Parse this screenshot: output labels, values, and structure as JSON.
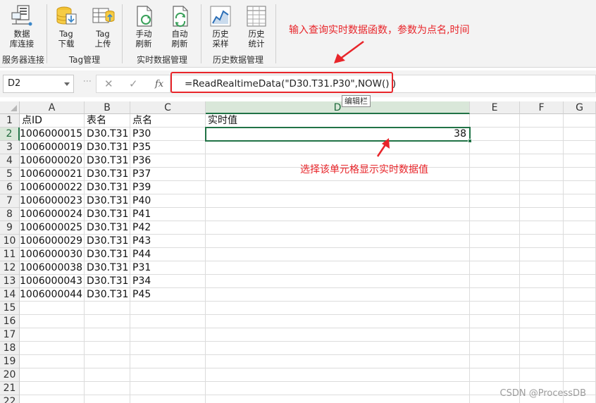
{
  "ribbon": {
    "buttons": [
      {
        "id": "db-connect",
        "label": "数据\n库连接",
        "icon": "server-connect-icon"
      },
      {
        "id": "tag-download",
        "label": "Tag\n下载",
        "icon": "database-download-icon"
      },
      {
        "id": "tag-upload",
        "label": "Tag\n上传",
        "icon": "table-upload-icon"
      },
      {
        "id": "manual-refresh",
        "label": "手动\n刷新",
        "icon": "document-refresh-icon"
      },
      {
        "id": "auto-refresh",
        "label": "自动\n刷新",
        "icon": "document-autorefresh-icon"
      },
      {
        "id": "history-sample",
        "label": "历史\n采样",
        "icon": "line-chart-icon"
      },
      {
        "id": "history-stats",
        "label": "历史\n统计",
        "icon": "spreadsheet-stats-icon"
      }
    ],
    "groups": {
      "server": "服务器连接",
      "tag": "Tag管理",
      "realtime": "实时数据管理",
      "history": "历史数据管理"
    }
  },
  "annotations": {
    "top": "输入查询实时数据函数，参数为点名,时间",
    "cell": "选择该单元格显示实时数据值"
  },
  "formula_bar": {
    "name_box": "D2",
    "fx": "fx",
    "formula": "=ReadRealtimeData(\"D30.T31.P30\",NOW() )",
    "tooltip": "编辑栏"
  },
  "sheet": {
    "columns": [
      "A",
      "B",
      "C",
      "D",
      "E",
      "F",
      "G"
    ],
    "selected_column": "D",
    "selected_row": 2,
    "row_numbers": [
      "1",
      "2",
      "3",
      "4",
      "5",
      "6",
      "7",
      "8",
      "9",
      "10",
      "11",
      "12",
      "13",
      "14",
      "15",
      "16",
      "17",
      "18",
      "19",
      "20",
      "21",
      "22"
    ],
    "headers": {
      "A": "点ID",
      "B": "表名",
      "C": "点名",
      "D": "实时值"
    },
    "rows": [
      [
        "1006000015",
        "D30.T31",
        "P30",
        "38"
      ],
      [
        "1006000019",
        "D30.T31",
        "P35",
        ""
      ],
      [
        "1006000020",
        "D30.T31",
        "P36",
        ""
      ],
      [
        "1006000021",
        "D30.T31",
        "P37",
        ""
      ],
      [
        "1006000022",
        "D30.T31",
        "P39",
        ""
      ],
      [
        "1006000023",
        "D30.T31",
        "P40",
        ""
      ],
      [
        "1006000024",
        "D30.T31",
        "P41",
        ""
      ],
      [
        "1006000025",
        "D30.T31",
        "P42",
        ""
      ],
      [
        "1006000029",
        "D30.T31",
        "P43",
        ""
      ],
      [
        "1006000030",
        "D30.T31",
        "P44",
        ""
      ],
      [
        "1006000038",
        "D30.T31",
        "P31",
        ""
      ],
      [
        "1006000043",
        "D30.T31",
        "P34",
        ""
      ],
      [
        "1006000044",
        "D30.T31",
        "P45",
        ""
      ]
    ]
  },
  "watermark": "CSDN @ProcessDB",
  "colors": {
    "annotation": "#e8252a",
    "selection": "#217346",
    "ribbon_bg": "#f3f3f3"
  }
}
